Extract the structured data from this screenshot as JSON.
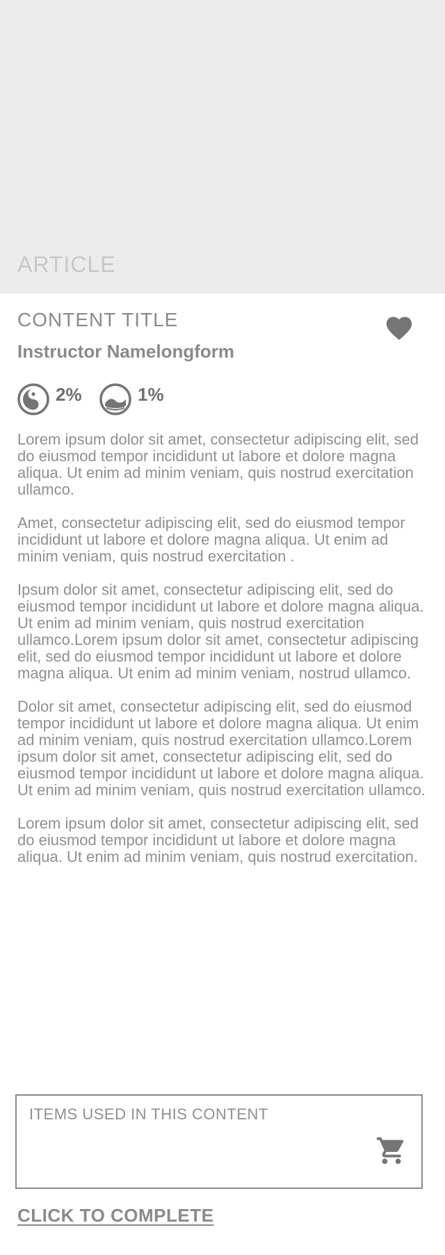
{
  "hero": {
    "label": "ARTICLE"
  },
  "content": {
    "title": "CONTENT TITLE",
    "instructor": "Instructor Namelongform",
    "favorite_icon": "heart-icon"
  },
  "stats": [
    {
      "icon": "yin-yang-icon",
      "value": "2%"
    },
    {
      "icon": "wave-icon",
      "value": "1%"
    }
  ],
  "body": {
    "paragraphs": [
      "Lorem ipsum dolor sit amet, consectetur adipiscing elit, sed do eiusmod tempor incididunt ut labore et dolore magna aliqua. Ut enim ad minim veniam, quis nostrud exercitation ullamco.",
      "Amet, consectetur adipiscing elit, sed do eiusmod tempor incididunt ut labore et dolore magna aliqua. Ut enim ad minim veniam, quis nostrud exercitation .",
      "Ipsum dolor sit amet, consectetur adipiscing elit, sed do eiusmod tempor incididunt ut labore et dolore magna aliqua. Ut enim ad minim veniam, quis nostrud exercitation ullamco.Lorem ipsum dolor sit amet, consectetur adipiscing elit, sed do eiusmod tempor incididunt ut labore et dolore magna aliqua. Ut enim ad minim veniam, nostrud ullamco.",
      "Dolor sit amet, consectetur adipiscing elit, sed do eiusmod tempor incididunt ut labore et dolore magna aliqua. Ut enim ad minim veniam, quis nostrud exercitation ullamco.Lorem ipsum dolor sit amet, consectetur adipiscing elit, sed do eiusmod tempor incididunt ut labore et dolore magna aliqua. Ut enim ad minim veniam, quis nostrud exercitation ullamco.",
      "Lorem ipsum dolor sit amet, consectetur adipiscing elit, sed do eiusmod tempor incididunt ut labore et dolore magna aliqua. Ut enim ad minim veniam, quis nostrud exercitation."
    ]
  },
  "items": {
    "label": "ITEMS USED IN THIS CONTENT",
    "cart_icon": "cart-icon"
  },
  "actions": {
    "complete_label": "CLICK TO COMPLETE"
  },
  "colors": {
    "hero_bg": "#ececec",
    "text": "#8f8f8f",
    "icon": "#757575"
  }
}
